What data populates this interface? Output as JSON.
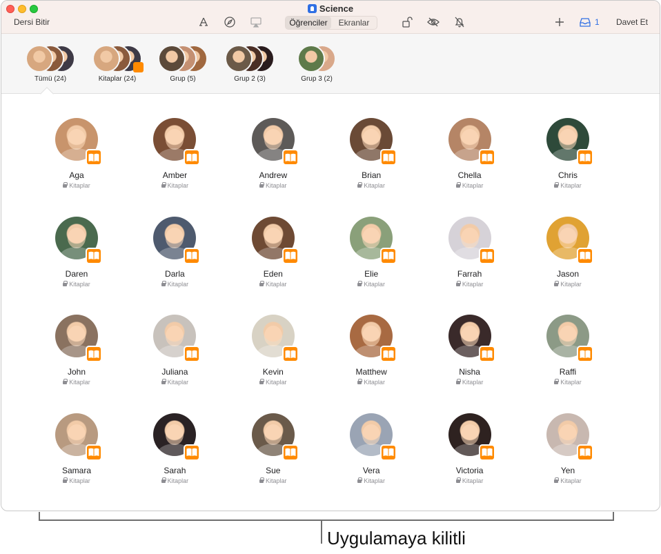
{
  "titlebar": {
    "app_title": "Science",
    "end_class_label": "Dersi Bitir",
    "invite_label": "Davet Et",
    "segment": {
      "students": "Öğrenciler",
      "screens": "Ekranlar",
      "selected": "Öğrenciler"
    },
    "inbox_count": "1",
    "icons": [
      "apps-icon",
      "navigate-icon",
      "airplay-icon",
      "lock-icon",
      "hide-icon",
      "mute-icon",
      "add-icon",
      "inbox-icon"
    ]
  },
  "groups": [
    {
      "label": "Tümü (24)",
      "colors": [
        "#d7a77f",
        "#8a5a3c",
        "#3e3a46"
      ],
      "book": false
    },
    {
      "label": "Kitaplar (24)",
      "colors": [
        "#d7a77f",
        "#8a5a3c",
        "#3e3a46"
      ],
      "book": true
    },
    {
      "label": "Grup (5)",
      "colors": [
        "#5c4a3a",
        "#c49072",
        "#a0683f"
      ],
      "book": false
    },
    {
      "label": "Grup 2 (3)",
      "colors": [
        "#6b5a48",
        "#4a2e25",
        "#2a1c1e"
      ],
      "book": false
    },
    {
      "label": "Grup 3 (2)",
      "colors": [
        "#5e7a4a",
        "#d9a88a"
      ],
      "book": false
    }
  ],
  "students": [
    {
      "name": "Aga",
      "status": "Kitaplar",
      "color": "#c8946c"
    },
    {
      "name": "Amber",
      "status": "Kitaplar",
      "color": "#7a4e35"
    },
    {
      "name": "Andrew",
      "status": "Kitaplar",
      "color": "#5d5a58"
    },
    {
      "name": "Brian",
      "status": "Kitaplar",
      "color": "#6a4a36"
    },
    {
      "name": "Chella",
      "status": "Kitaplar",
      "color": "#b58566"
    },
    {
      "name": "Chris",
      "status": "Kitaplar",
      "color": "#2e4a3a"
    },
    {
      "name": "Daren",
      "status": "Kitaplar",
      "color": "#4a6a4e"
    },
    {
      "name": "Darla",
      "status": "Kitaplar",
      "color": "#4e5a6e"
    },
    {
      "name": "Eden",
      "status": "Kitaplar",
      "color": "#6e4a34"
    },
    {
      "name": "Elie",
      "status": "Kitaplar",
      "color": "#8aa07a"
    },
    {
      "name": "Farrah",
      "status": "Kitaplar",
      "color": "#d6d2d8"
    },
    {
      "name": "Jason",
      "status": "Kitaplar",
      "color": "#e0a233"
    },
    {
      "name": "John",
      "status": "Kitaplar",
      "color": "#8a7260"
    },
    {
      "name": "Juliana",
      "status": "Kitaplar",
      "color": "#c8c2bc"
    },
    {
      "name": "Kevin",
      "status": "Kitaplar",
      "color": "#d8d2c4"
    },
    {
      "name": "Matthew",
      "status": "Kitaplar",
      "color": "#a86a42"
    },
    {
      "name": "Nisha",
      "status": "Kitaplar",
      "color": "#3a2a2a"
    },
    {
      "name": "Raffi",
      "status": "Kitaplar",
      "color": "#8c9a86"
    },
    {
      "name": "Samara",
      "status": "Kitaplar",
      "color": "#b89a80"
    },
    {
      "name": "Sarah",
      "status": "Kitaplar",
      "color": "#2a2224"
    },
    {
      "name": "Sue",
      "status": "Kitaplar",
      "color": "#6a5a4a"
    },
    {
      "name": "Vera",
      "status": "Kitaplar",
      "color": "#9aa4b4"
    },
    {
      "name": "Victoria",
      "status": "Kitaplar",
      "color": "#2e2220"
    },
    {
      "name": "Yen",
      "status": "Kitaplar",
      "color": "#c8b8b0"
    }
  ],
  "callout": {
    "text": "Uygulamaya kilitli"
  },
  "colors": {
    "accent": "#2f6fe4",
    "book_badge": "#ff8a00",
    "titlebar_bg": "#f8efec"
  }
}
